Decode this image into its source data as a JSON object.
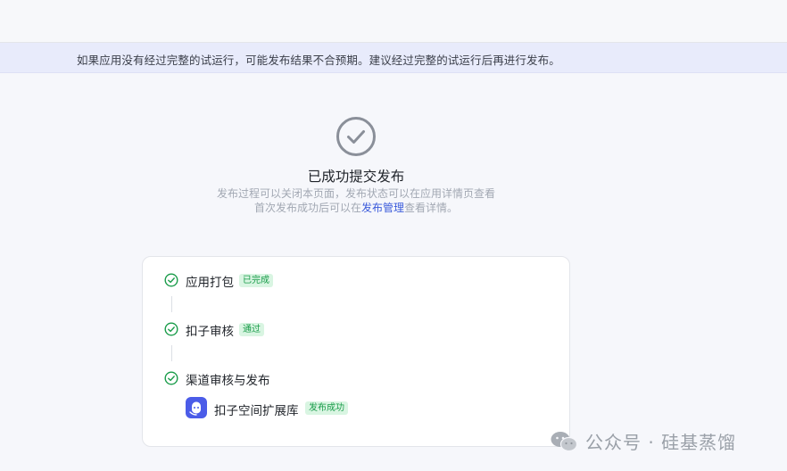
{
  "banner": {
    "message": "如果应用没有经过完整的试运行，可能发布结果不合预期。建议经过完整的试运行后再进行发布。"
  },
  "result": {
    "title": "已成功提交发布",
    "desc_line1": "发布过程可以关闭本页面，发布状态可以在应用详情页查看",
    "desc_line2_prefix": "首次发布成功后可以在",
    "desc_line2_link": "发布管理",
    "desc_line2_suffix": "查看详情。"
  },
  "steps": [
    {
      "label": "应用打包",
      "status": "已完成",
      "icon": "check-circle-icon"
    },
    {
      "label": "扣子审核",
      "status": "通过",
      "icon": "check-circle-icon"
    },
    {
      "label": "渠道审核与发布",
      "icon": "check-circle-icon"
    }
  ],
  "channel": {
    "name": "扣子空间扩展库",
    "status": "发布成功",
    "icon": "coze-space-icon"
  },
  "watermark": {
    "text": "公众号 · 硅基蒸馏",
    "icon": "wechat-icon"
  },
  "colors": {
    "accent": "#3b5bdb",
    "success": "#1a9c4a",
    "success_bg": "#d9f5e2",
    "banner_bg": "#e8ebfb",
    "app_icon": "#4b5ce8"
  }
}
